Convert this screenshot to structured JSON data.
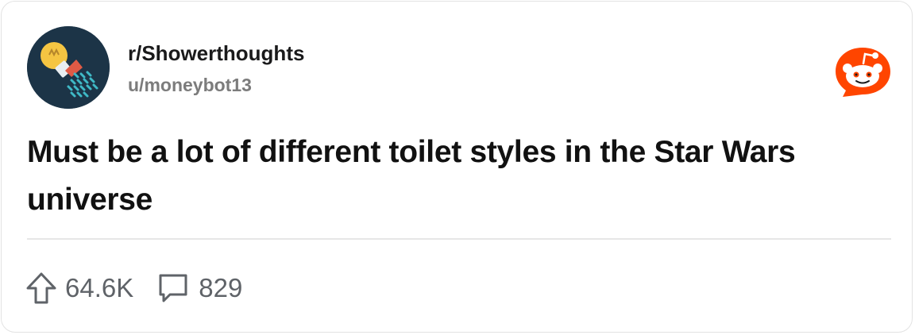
{
  "post": {
    "subreddit": "r/Showerthoughts",
    "author": "u/moneybot13",
    "title": "Must be a lot of different toilet styles in the Star Wars universe"
  },
  "stats": {
    "upvotes": "64.6K",
    "comments": "829"
  },
  "icons": {
    "avatar": "lightbulb-shower-icon",
    "brand": "reddit-logo-icon",
    "upvote": "upvote-arrow-icon",
    "comment": "comment-bubble-icon"
  },
  "colors": {
    "avatar_bg": "#1c3447",
    "reddit_orange": "#ff4500",
    "text_primary": "#1a1a1b",
    "text_secondary": "#7c7c7c",
    "divider": "#e6e6e6"
  }
}
